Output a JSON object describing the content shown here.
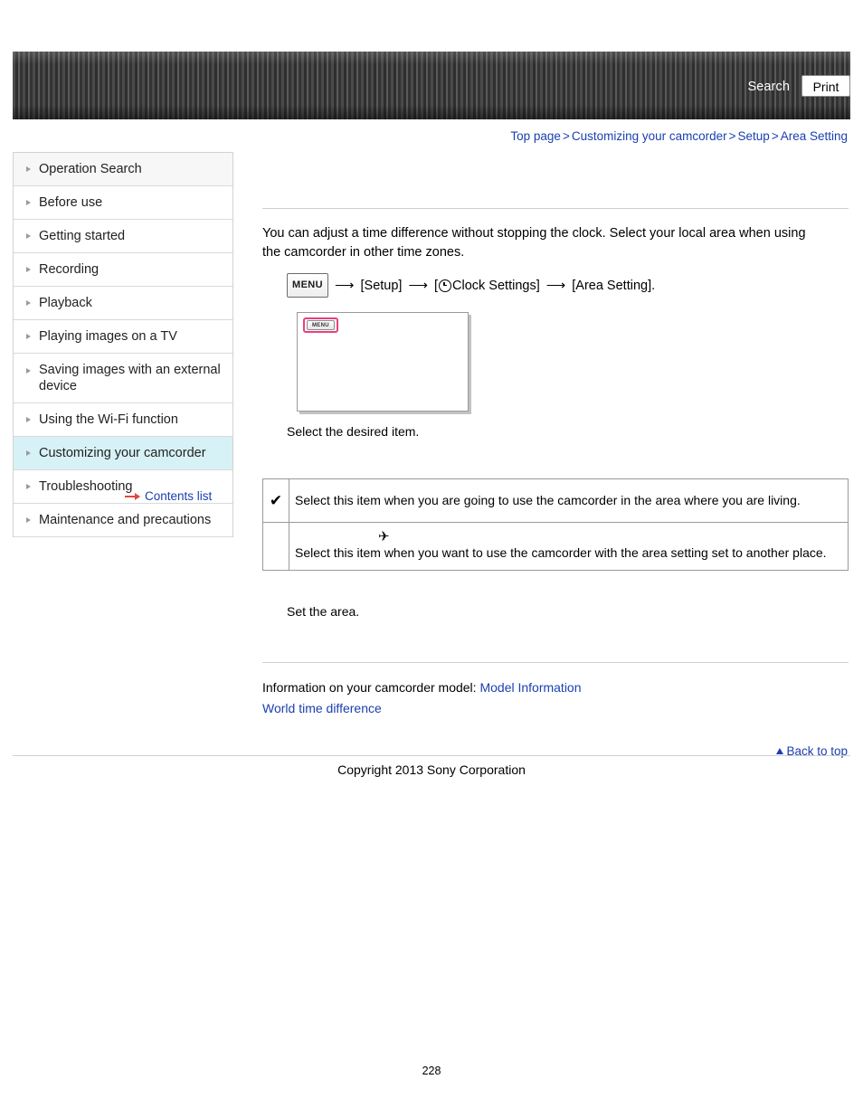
{
  "header": {
    "search_label": "Search",
    "print_label": "Print"
  },
  "breadcrumb": {
    "items": [
      {
        "label": "Top page"
      },
      {
        "label": "Customizing your camcorder"
      },
      {
        "label": "Setup"
      },
      {
        "label": "Area Setting"
      }
    ],
    "separator": ">"
  },
  "sidebar": {
    "items": [
      {
        "label": "Operation Search"
      },
      {
        "label": "Before use"
      },
      {
        "label": "Getting started"
      },
      {
        "label": "Recording"
      },
      {
        "label": "Playback"
      },
      {
        "label": "Playing images on a TV"
      },
      {
        "label": "Saving images with an external device"
      },
      {
        "label": "Using the Wi-Fi function"
      },
      {
        "label": "Customizing your camcorder"
      },
      {
        "label": "Troubleshooting"
      },
      {
        "label": "Maintenance and precautions"
      }
    ],
    "contents_list_label": "Contents list"
  },
  "main": {
    "intro": "You can adjust a time difference without stopping the clock. Select your local area when using the camcorder in other time zones.",
    "step": {
      "menu_chip": "MENU",
      "arrow": "⟶",
      "setup": "[Setup]",
      "clock_settings_prefix": "[",
      "clock_settings": "Clock Settings]",
      "area_setting": "[Area Setting]."
    },
    "figure": {
      "menu_button_label": "MENU"
    },
    "caption": "Select the desired item.",
    "table": {
      "rows": [
        {
          "mark": "✔",
          "glyph": "",
          "description": "Select this item when you are going to use the camcorder in the area where you are living."
        },
        {
          "mark": "",
          "glyph": "✈",
          "description": "Select this item when you want to use the camcorder with the area setting set to another place."
        }
      ]
    },
    "set_area": "Set the area.",
    "info_text": "Information on your camcorder model:",
    "model_information_link": "Model Information",
    "world_time_link": "World time difference"
  },
  "footer": {
    "back_to_top": "Back to top",
    "copyright": "Copyright 2013 Sony Corporation",
    "page_number": "228"
  }
}
